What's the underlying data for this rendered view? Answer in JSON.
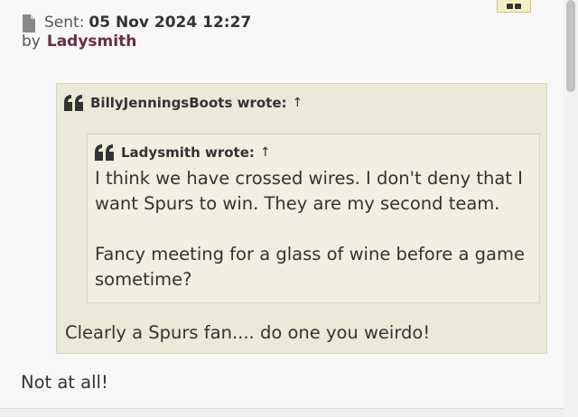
{
  "post": {
    "sent_label": "Sent:",
    "sent_date": "05 Nov 2024 12:27",
    "by_label": "by",
    "author": "Ladysmith",
    "icons": {
      "file": "file-icon",
      "quote": "quote-icon",
      "quick_quote": "quote-button-icon"
    },
    "outer_quote": {
      "cite_author": "BillyJenningsBoots",
      "cite_suffix": "wrote:",
      "arrow": "↑",
      "inner_quote": {
        "cite_author": "Ladysmith",
        "cite_suffix": "wrote:",
        "arrow": "↑",
        "paragraphs": [
          "I think we have crossed wires. I don't deny that I want Spurs to win. They are my second team.",
          "Fancy meeting for a glass of wine before a game sometime?"
        ]
      },
      "text": "Clearly a Spurs fan.... do one you weirdo!"
    },
    "reply_text": "Not at all!"
  },
  "colors": {
    "author": "#6b2d3f",
    "quote_bg": "#ebead9",
    "inner_quote_bg": "#f0efe0",
    "quote_border": "#d6d4bd",
    "page_bg": "#f7f7f7"
  }
}
